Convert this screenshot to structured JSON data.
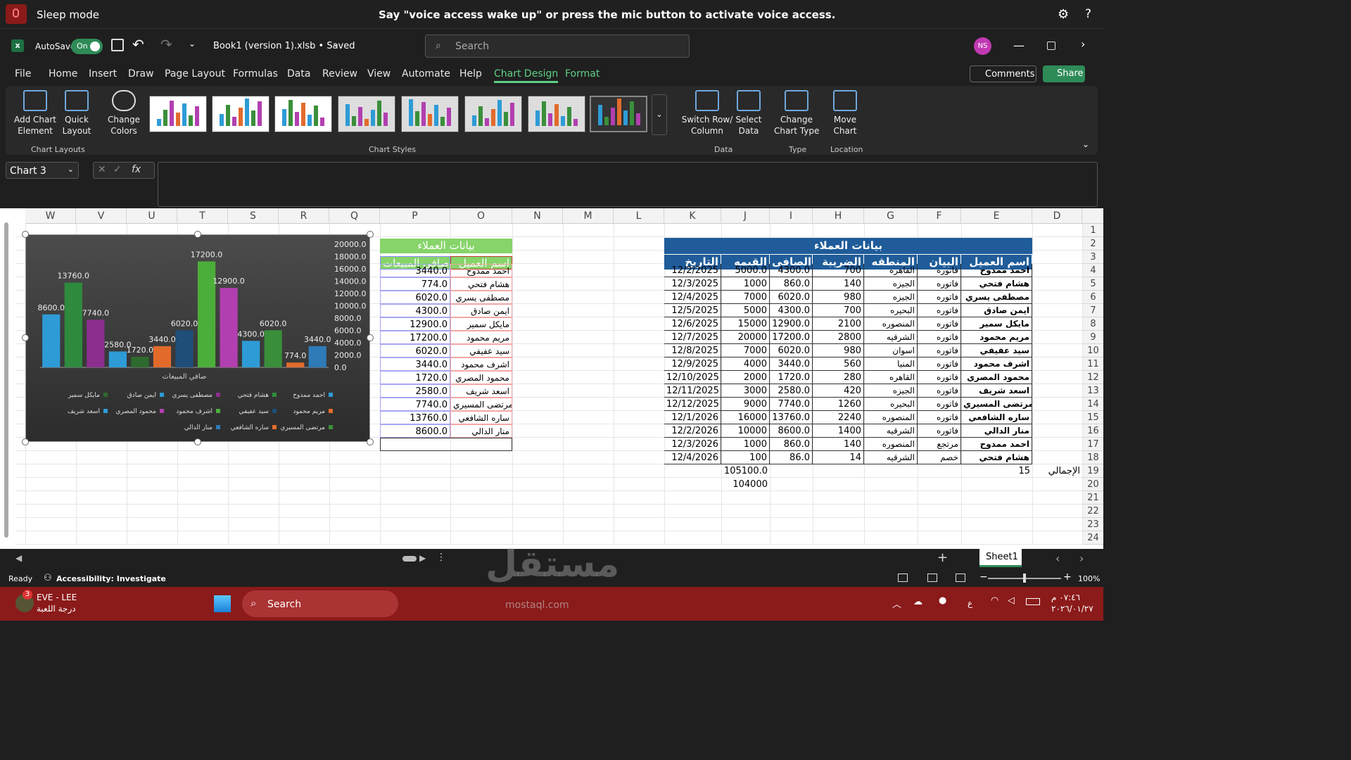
{
  "voice": {
    "mode": "Sleep mode",
    "message": "Say \"voice access wake up\" or press the mic button to activate voice access."
  },
  "titlebar": {
    "autosave": "AutoSave",
    "toggle": "On",
    "filename": "Book1 (version 1).xlsb • Saved",
    "search_placeholder": "Search",
    "avatar": "NS"
  },
  "menu": [
    "File",
    "Home",
    "Insert",
    "Draw",
    "Page Layout",
    "Formulas",
    "Data",
    "Review",
    "View",
    "Automate",
    "Help",
    "Chart Design",
    "Format"
  ],
  "menu_actions": {
    "comments": "Comments",
    "share": "Share"
  },
  "ribbon": {
    "add_chart": "Add Chart\nElement",
    "quick_layout": "Quick\nLayout",
    "change_colors": "Change\nColors",
    "switch_row": "Switch Row/\nColumn",
    "select_data": "Select\nData",
    "change_type": "Change\nChart Type",
    "move_chart": "Move\nChart",
    "grp_layouts": "Chart Layouts",
    "grp_styles": "Chart Styles",
    "grp_data": "Data",
    "grp_type": "Type",
    "grp_location": "Location"
  },
  "formula": {
    "namebox": "Chart 3",
    "fx": "fx"
  },
  "columns": [
    "W",
    "V",
    "U",
    "T",
    "S",
    "R",
    "Q",
    "P",
    "O",
    "N",
    "M",
    "L",
    "K",
    "J",
    "I",
    "H",
    "G",
    "F",
    "E",
    "D"
  ],
  "rows": [
    "1",
    "2",
    "3",
    "4",
    "5",
    "6",
    "7",
    "8",
    "9",
    "10",
    "11",
    "12",
    "13",
    "14",
    "15",
    "16",
    "17",
    "18",
    "19",
    "20",
    "21",
    "22",
    "23",
    "24"
  ],
  "table1": {
    "title": "بيانات العملاء",
    "headers": [
      "اسم العميل",
      "البيان",
      "المنطقه",
      "الضريبة",
      "الصافى",
      "القيمه",
      "التاريخ"
    ],
    "rows": [
      [
        "احمد ممدوح",
        "فاتوره",
        "القاهره",
        "700",
        "4300.0",
        "5000.0",
        "12/2/2025"
      ],
      [
        "هشام  فتحي",
        "فاتوره",
        "الجيزه",
        "140",
        "860.0",
        "1000",
        "12/3/2025"
      ],
      [
        "مصطفى يسري",
        "فاتوره",
        "الجيزه",
        "980",
        "6020.0",
        "7000",
        "12/4/2025"
      ],
      [
        "ايمن صادق",
        "فاتوره",
        "البحيره",
        "700",
        "4300.0",
        "5000",
        "12/5/2025"
      ],
      [
        "مايكل سمير",
        "فاتوره",
        "المنصوره",
        "2100",
        "12900.0",
        "15000",
        "12/6/2025"
      ],
      [
        "مريم محمود",
        "فاتوره",
        "الشرقيه",
        "2800",
        "17200.0",
        "20000",
        "12/7/2025"
      ],
      [
        "سيد عفيفي",
        "فاتوره",
        "اسوان",
        "980",
        "6020.0",
        "7000",
        "12/8/2025"
      ],
      [
        "اشرف محمود",
        "فاتوره",
        "المنيا",
        "560",
        "3440.0",
        "4000",
        "12/9/2025"
      ],
      [
        "محمود المصري",
        "فاتوره",
        "القاهره",
        "280",
        "1720.0",
        "2000",
        "12/10/2025"
      ],
      [
        "اسعد شريف",
        "فاتوره",
        "الجيزه",
        "420",
        "2580.0",
        "3000",
        "12/11/2025"
      ],
      [
        "مرتضى المسيري",
        "فاتوره",
        "البحيره",
        "1260",
        "7740.0",
        "9000",
        "12/12/2025"
      ],
      [
        "ساره الشافعي",
        "فاتوره",
        "المنصوره",
        "2240",
        "13760.0",
        "16000",
        "12/1/2026"
      ],
      [
        "منار الدالي",
        "فاتوره",
        "الشرقيه",
        "1400",
        "8600.0",
        "10000",
        "12/2/2026"
      ],
      [
        "احمد ممدوح",
        "مرتجع",
        "المنصوره",
        "140",
        "860.0",
        "1000",
        "12/3/2026"
      ],
      [
        "هشام  فتحي",
        "خصم",
        "الشرقيه",
        "14",
        "86.0",
        "100",
        "12/4/2026"
      ]
    ],
    "total_label": "الإجمالي",
    "count": "15",
    "total1": "105100.0",
    "total2": "104000"
  },
  "table2": {
    "title": "بيانات العملاء",
    "headers": [
      "اسم العميل",
      "صافي المبيعات"
    ],
    "rows": [
      [
        "احمد ممدوح",
        "3440.0"
      ],
      [
        "هشام  فتحي",
        "774.0"
      ],
      [
        "مصطفى يسري",
        "6020.0"
      ],
      [
        "ايمن صادق",
        "4300.0"
      ],
      [
        "مايكل سمير",
        "12900.0"
      ],
      [
        "مريم محمود",
        "17200.0"
      ],
      [
        "سيد عفيفي",
        "6020.0"
      ],
      [
        "اشرف محمود",
        "3440.0"
      ],
      [
        "محمود المصري",
        "1720.0"
      ],
      [
        "اسعد شريف",
        "2580.0"
      ],
      [
        "مرتضى المسيري",
        "7740.0"
      ],
      [
        "ساره الشافعي",
        "13760.0"
      ],
      [
        "منار الدالي",
        "8600.0"
      ]
    ]
  },
  "chart_data": {
    "type": "bar",
    "title": "",
    "xlabel": "صافي المبيعات",
    "ylim": [
      0,
      20000
    ],
    "yticks": [
      "20000.0",
      "18000.0",
      "16000.0",
      "14000.0",
      "12000.0",
      "10000.0",
      "8000.0",
      "6000.0",
      "4000.0",
      "2000.0",
      "0.0"
    ],
    "series": [
      {
        "name": "احمد ممدوح",
        "value": 8600,
        "color": "#2e9bd6"
      },
      {
        "name": "هشام  فتحي",
        "value": 13760,
        "color": "#2e8b3e"
      },
      {
        "name": "مصطفى يسري",
        "value": 7740,
        "color": "#8b2f8e"
      },
      {
        "name": "ايمن صادق",
        "value": 2580,
        "color": "#2e9bd6"
      },
      {
        "name": "مايكل سمير",
        "value": 1720,
        "color": "#2e6a2e"
      },
      {
        "name": "مريم محمود",
        "value": 3440,
        "color": "#e26b2c"
      },
      {
        "name": "سيد عفيفي",
        "value": 6020,
        "color": "#1f4e79"
      },
      {
        "name": "اشرف محمود",
        "value": 17200,
        "color": "#4cae3a"
      },
      {
        "name": "محمود المصري",
        "value": 12900,
        "color": "#b23fb0"
      },
      {
        "name": "اسعد شريف",
        "value": 4300,
        "color": "#2e9bd6"
      },
      {
        "name": "مرتضى المسيري",
        "value": 6020,
        "color": "#3a8f3a"
      },
      {
        "name": "ساره الشافعي",
        "value": 774,
        "color": "#e26b2c"
      },
      {
        "name": "منار الدالي",
        "value": 3440,
        "color": "#2e7bb8"
      }
    ],
    "labels": [
      "8600.0",
      "13760.0",
      "7740.0",
      "2580.0",
      "1720.0",
      "3440.0",
      "6020.0",
      "17200.0",
      "12900.0",
      "4300.0",
      "6020.0",
      "774.0",
      "3440.0"
    ]
  },
  "sheet_tabs": {
    "active": "Sheet1"
  },
  "status": {
    "ready": "Ready",
    "accessibility": "Accessibility: Investigate",
    "zoom": "100%"
  },
  "taskbar": {
    "user": "EVE - LEE",
    "user_sub": "درجة اللعبة",
    "search": "Search",
    "time": "٠٧:٤٦ م",
    "date": "٢٠٢٦/٠١/٢٧",
    "lang": "ع",
    "badge": "3"
  },
  "watermark": {
    "ar": "مستقل",
    "en": "mostaql.com"
  }
}
